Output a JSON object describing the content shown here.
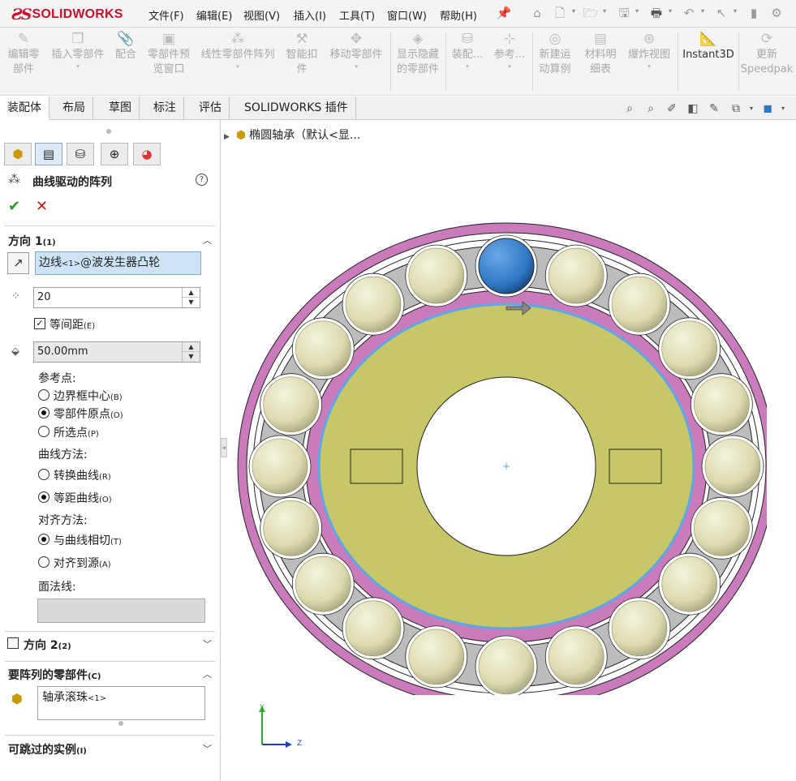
{
  "app": {
    "logo_ds": "ƧS",
    "logo_name": "SOLIDWORKS"
  },
  "menu": [
    "文件(F)",
    "编辑(E)",
    "视图(V)",
    "插入(I)",
    "工具(T)",
    "窗口(W)",
    "帮助(H)"
  ],
  "ribbon": {
    "edit_part_1": "编辑零",
    "edit_part_2": "部件",
    "insert_part": "插入零部件",
    "mate": "配合",
    "preview_1": "零部件预",
    "preview_2": "览窗口",
    "linear_pattern": "线性零部件阵列",
    "smart_fastener_1": "智能扣",
    "smart_fastener_2": "件",
    "move_part": "移动零部件",
    "show_hidden_1": "显示隐藏",
    "show_hidden_2": "的零部件",
    "assembly": "装配...",
    "reference": "参考...",
    "new_motion_1": "新建运",
    "new_motion_2": "动算例",
    "bom_1": "材料明",
    "bom_2": "细表",
    "exploded": "爆炸视图",
    "instant3d": "Instant3D",
    "update_1": "更新",
    "update_2": "Speedpak"
  },
  "tabs": [
    "装配体",
    "布局",
    "草图",
    "标注",
    "评估",
    "SOLIDWORKS 插件"
  ],
  "panel": {
    "title": "曲线驱动的阵列",
    "help": "?",
    "ok": "✔",
    "cancel": "✕",
    "direction1": {
      "title": "方向 1",
      "count_tag": "(1)"
    },
    "edge_main": "边线",
    "edge_tag": "<1>",
    "edge_rest": "@波发生器凸轮",
    "instances": "20",
    "equal_spacing_main": "等间距",
    "equal_spacing_key": "(E)",
    "spacing": "50.00mm",
    "reference_point": "参考点:",
    "ref_options": [
      {
        "main": "边界框中心",
        "key": "(B)",
        "selected": false
      },
      {
        "main": "零部件原点",
        "key": "(O)",
        "selected": true
      },
      {
        "main": "所选点",
        "key": "(P)",
        "selected": false
      }
    ],
    "curve_method": "曲线方法:",
    "curve_options": [
      {
        "main": "转换曲线",
        "key": "(R)",
        "selected": false
      },
      {
        "main": "等距曲线",
        "key": "(O)",
        "selected": true
      }
    ],
    "align_method": "对齐方法:",
    "align_options": [
      {
        "main": "与曲线相切",
        "key": "(T)",
        "selected": true
      },
      {
        "main": "对齐到源",
        "key": "(A)",
        "selected": false
      }
    ],
    "face_normal": "面法线:",
    "direction2": {
      "title": "方向 2",
      "count_tag": "(2)"
    },
    "components": {
      "title": "要阵列的零部件",
      "key": "(C)"
    },
    "component_main": "轴承滚珠",
    "component_tag": "<1>",
    "skip": {
      "title": "可跳过的实例",
      "key": "(I)"
    }
  },
  "tree": {
    "name": "椭圆轴承（默认<显..."
  },
  "triad": {
    "y": "Y",
    "z": "Z"
  },
  "colors": {
    "outer_ring": "#c97bbc",
    "cam": "#c8c768",
    "edge_highlight": "#5aa9e6",
    "ball": "#d9d7a8",
    "seed_ball": "#2f78c4",
    "cage": "#bcbcbc"
  },
  "model": {
    "ball_count": 20
  }
}
